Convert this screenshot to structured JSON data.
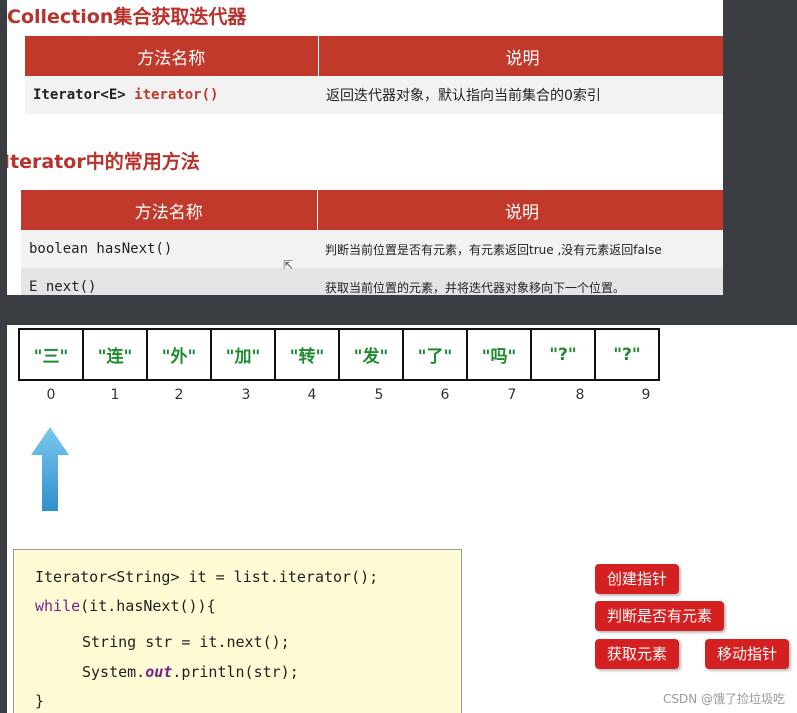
{
  "slide1": {
    "heading1": "Collection集合获取迭代器",
    "table1": {
      "headers": [
        "方法名称",
        "说明"
      ],
      "rows": [
        {
          "method_prefix": "Iterator<E> ",
          "method_name": "iterator()",
          "desc": "返回迭代器对象，默认指向当前集合的0索引"
        }
      ]
    },
    "heading2": "Iterator中的常用方法",
    "table2": {
      "headers": [
        "方法名称",
        "说明"
      ],
      "rows": [
        {
          "method": "boolean hasNext()",
          "desc": "判断当前位置是否有元素，有元素返回true ,没有元素返回false"
        },
        {
          "method": "E next()",
          "desc": "获取当前位置的元素，并将迭代器对象移向下一个位置。"
        }
      ]
    }
  },
  "slide2": {
    "cells": [
      "\"三\"",
      "\"连\"",
      "\"外\"",
      "\"加\"",
      "\"转\"",
      "\"发\"",
      "\"了\"",
      "\"吗\"",
      "\"?\"",
      "\"?\""
    ],
    "indices": [
      "0",
      "1",
      "2",
      "3",
      "4",
      "5",
      "6",
      "7",
      "8",
      "9"
    ],
    "code": {
      "l1": "Iterator<String> it = list.iterator();",
      "l2_kw": "while",
      "l2_rest": "(it.hasNext()){",
      "l3": "String str = it.next();",
      "l4_a": "System.",
      "l4_b": "out",
      "l4_c": ".println(str);",
      "l5": "}"
    },
    "buttons": {
      "create": "创建指针",
      "check": "判断是否有元素",
      "get": "获取元素",
      "move": "移动指针"
    },
    "watermark": "CSDN @饿了捡垃圾吃"
  },
  "colors": {
    "accent_red": "#c0392b",
    "button_red": "#d42020",
    "cell_green": "#1e8b2e",
    "arrow_blue": "#4aa8d8",
    "code_bg": "#fffbd4"
  }
}
